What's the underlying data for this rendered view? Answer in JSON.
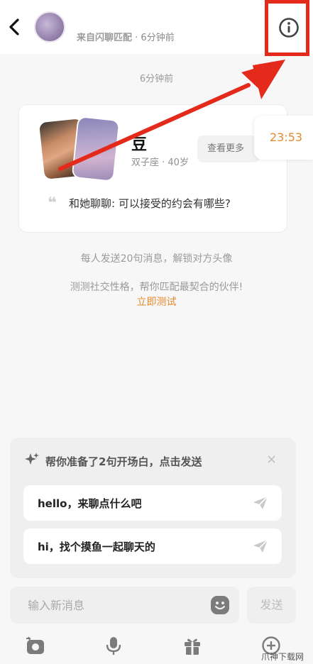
{
  "header": {
    "source": "来自闪聊匹配",
    "time_ago": "· 6分钟前"
  },
  "chat": {
    "time_divider": "6分钟前",
    "card": {
      "name": "豆",
      "meta": "双子座 · 40岁",
      "more_label": "查看更多",
      "quote": "❝",
      "question": "和她聊聊: 可以接受的约会有哪些?"
    },
    "side_time": "23:53",
    "hint_unlock": "每人发送20句消息，解锁对方头像",
    "hint_test": "测测社交性格，帮你匹配最契合的伙伴!",
    "test_link": "立即测试"
  },
  "opener": {
    "title": "帮你准备了2句开场白，点击发送",
    "close": "×",
    "suggestions": [
      {
        "text": "hello，来聊点什么吧"
      },
      {
        "text": "hi，找个摸鱼一起聊天的"
      }
    ]
  },
  "input": {
    "placeholder": "输入新消息",
    "send_label": "发送"
  },
  "watermark": "爪神下载网",
  "colors": {
    "accent": "#e6892d",
    "annotation": "#e32a1b"
  },
  "icons": [
    "back-icon",
    "info-icon",
    "sparkle-icon",
    "send-plane-icon",
    "emoji-icon",
    "photo-icon",
    "microphone-icon",
    "gift-icon",
    "plus-circle-icon"
  ]
}
